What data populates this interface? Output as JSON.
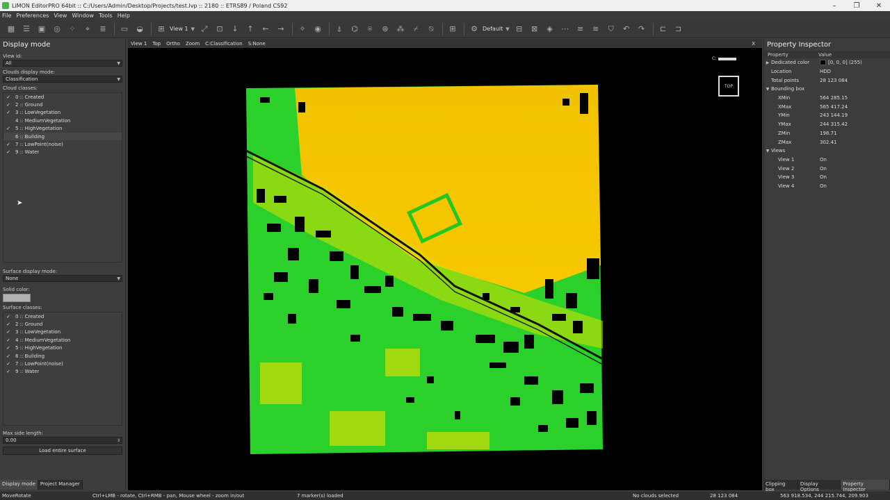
{
  "window": {
    "title": "LiMON EditorPRO 64bit :: C:/Users/Admin/Desktop/Projects/test.lvp :: 2180 :: ETRS89 / Poland CS92"
  },
  "menu": [
    "File",
    "Preferences",
    "View",
    "Window",
    "Tools",
    "Help"
  ],
  "toolbar": {
    "view_combo": "View 1",
    "profile_combo": "Default"
  },
  "left_panel": {
    "title": "Display mode",
    "view_id_label": "View id:",
    "view_id_value": "All",
    "clouds_mode_label": "Clouds display mode:",
    "clouds_mode_value": "Classification",
    "cloud_classes_label": "Cloud classes:",
    "cloud_classes": [
      {
        "label": "0 :: Created",
        "checked": true
      },
      {
        "label": "2 :: Ground",
        "checked": true
      },
      {
        "label": "3 :: LowVegetation",
        "checked": true
      },
      {
        "label": "4 :: MediumVegetation",
        "checked": false
      },
      {
        "label": "5 :: HighVegetation",
        "checked": true
      },
      {
        "label": "6 :: Building",
        "checked": false
      },
      {
        "label": "7 :: LowPoint(noise)",
        "checked": true
      },
      {
        "label": "9 :: Water",
        "checked": true
      }
    ],
    "surface_mode_label": "Surface display mode:",
    "surface_mode_value": "None",
    "solid_color_label": "Solid color:",
    "surface_classes_label": "Surface classes:",
    "surface_classes": [
      {
        "label": "0 :: Created",
        "checked": true
      },
      {
        "label": "2 :: Ground",
        "checked": true
      },
      {
        "label": "3 :: LowVegetation",
        "checked": true
      },
      {
        "label": "4 :: MediumVegetation",
        "checked": true
      },
      {
        "label": "5 :: HighVegetation",
        "checked": true
      },
      {
        "label": "6 :: Building",
        "checked": true
      },
      {
        "label": "7 :: LowPoint(noise)",
        "checked": true
      },
      {
        "label": "9 :: Water",
        "checked": true
      }
    ],
    "max_side_label": "Max side length:",
    "max_side_value": "0.00",
    "load_button": "Load entire surface",
    "tabs": [
      "Display mode",
      "Project Manager"
    ]
  },
  "viewport": {
    "tabs": [
      "View 1",
      "Top",
      "Ortho",
      "Zoom",
      "C:Classification",
      "S:None"
    ],
    "close": "X",
    "top_badge": "TOP",
    "scale_label": "C:"
  },
  "property_inspector": {
    "title": "Property Inspector",
    "col_property": "Property",
    "col_value": "Value",
    "dedicated_color_label": "Dedicated color",
    "dedicated_color_value": "[0, 0, 0] (255)",
    "location_label": "Location",
    "location_value": "HDD",
    "total_points_label": "Total points",
    "total_points_value": "28 123 084",
    "bbox_label": "Bounding box",
    "bbox": [
      {
        "k": "XMin",
        "v": "564 285.15"
      },
      {
        "k": "XMax",
        "v": "565 417.24"
      },
      {
        "k": "YMin",
        "v": "243 144.19"
      },
      {
        "k": "YMax",
        "v": "244 315.42"
      },
      {
        "k": "ZMin",
        "v": "198.71"
      },
      {
        "k": "ZMax",
        "v": "302.41"
      }
    ],
    "views_label": "Views",
    "views": [
      {
        "k": "View 1",
        "v": "On"
      },
      {
        "k": "View 2",
        "v": "On"
      },
      {
        "k": "View 3",
        "v": "On"
      },
      {
        "k": "View 4",
        "v": "On"
      }
    ],
    "tabs": [
      "Clipping box",
      "Display Options",
      "Property Inspector"
    ]
  },
  "status": {
    "mode": "MoveRotate",
    "hint": "Ctrl+LMB - rotate, Ctrl+RMB - pan, Mouse wheel - zoom in/out",
    "markers": "7 marker(s) loaded",
    "selection": "No clouds selected",
    "points": "28 123 084",
    "coords": "563 918.534, 244 215.744, 209.903"
  },
  "colors": {
    "ground_yellow": "#f2c200",
    "vegetation_green": "#22d322",
    "building_black": "#000000"
  }
}
